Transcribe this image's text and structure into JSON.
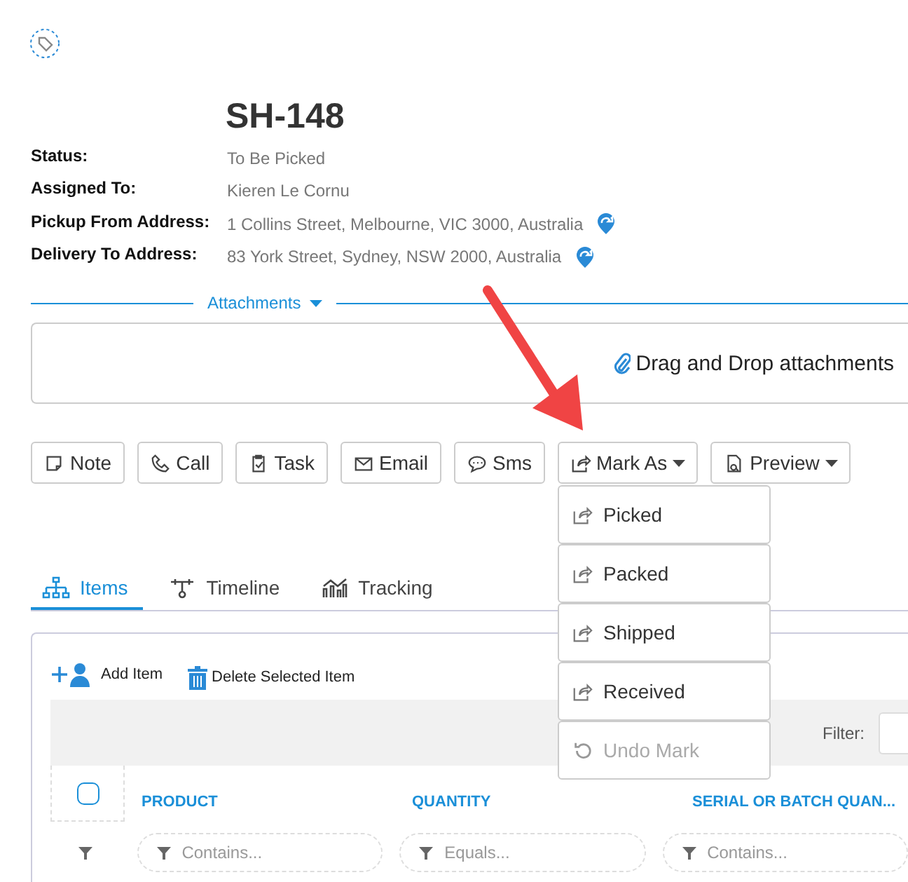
{
  "title": "SH-148",
  "details": [
    {
      "label": "Status:",
      "value": "To Be Picked",
      "kind": "text"
    },
    {
      "label": "Assigned To:",
      "value": "Kieren Le Cornu",
      "kind": "text"
    },
    {
      "label": "Pickup From Address:",
      "value": "1 Collins Street, Melbourne, VIC 3000, Australia",
      "kind": "address"
    },
    {
      "label": "Delivery To Address:",
      "value": "83 York Street, Sydney, NSW 2000, Australia",
      "kind": "address"
    }
  ],
  "attachments": {
    "label": "Attachments",
    "dropzone": "Drag and Drop attachments"
  },
  "actions": [
    {
      "label": "Note",
      "kind": "note",
      "dropdown": false
    },
    {
      "label": "Call",
      "kind": "call",
      "dropdown": false
    },
    {
      "label": "Task",
      "kind": "task",
      "dropdown": false
    },
    {
      "label": "Email",
      "kind": "email",
      "dropdown": false
    },
    {
      "label": "Sms",
      "kind": "sms",
      "dropdown": false
    },
    {
      "label": "Mark As",
      "kind": "mark",
      "dropdown": true
    },
    {
      "label": "Preview",
      "kind": "preview",
      "dropdown": true
    }
  ],
  "mark_menu": [
    {
      "label": "Picked",
      "kind": "mark",
      "disabled": false
    },
    {
      "label": "Packed",
      "kind": "mark",
      "disabled": false
    },
    {
      "label": "Shipped",
      "kind": "mark",
      "disabled": false
    },
    {
      "label": "Received",
      "kind": "mark",
      "disabled": false
    },
    {
      "label": "Undo Mark",
      "kind": "undo",
      "disabled": true
    }
  ],
  "tabs": [
    {
      "label": "Items",
      "kind": "items",
      "selected": true
    },
    {
      "label": "Timeline",
      "kind": "timeline",
      "selected": false
    },
    {
      "label": "Tracking",
      "kind": "tracking",
      "selected": false
    }
  ],
  "toolbar": [
    {
      "label": "Add Item",
      "kind": "add"
    },
    {
      "label": "Delete Selected Item",
      "kind": "delete"
    }
  ],
  "filter": {
    "label": "Filter:"
  },
  "table": {
    "select_all": {
      "checked": false
    },
    "columns": [
      {
        "label": "PRODUCT",
        "filter": "Contains..."
      },
      {
        "label": "QUANTITY",
        "filter": "Equals..."
      },
      {
        "label": "SERIAL OR BATCH QUAN...",
        "filter": "Contains..."
      }
    ]
  }
}
